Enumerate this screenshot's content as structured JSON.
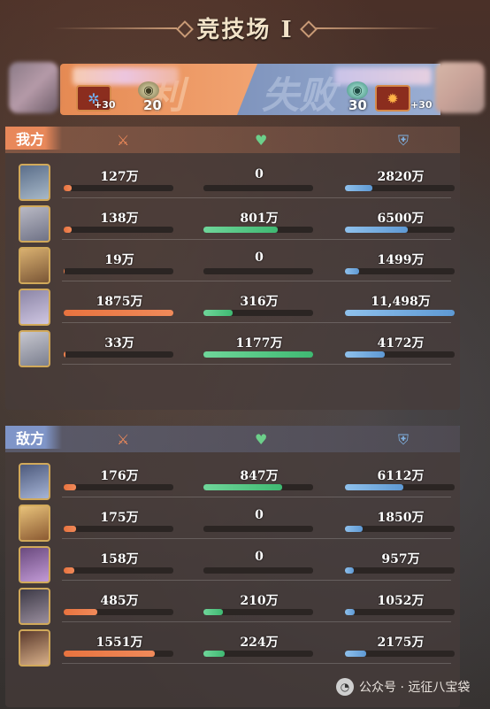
{
  "title": "竞技场 I",
  "banner": {
    "win_text": "利",
    "lose_text": "失败",
    "left_bonus": "+30",
    "left_level": "20",
    "right_level": "30",
    "right_bonus": "+30"
  },
  "stat_icons": {
    "damage": "sword-icon",
    "heal": "heart-icon",
    "defense": "shield-icon"
  },
  "colors": {
    "our_side": "#e8885a",
    "enemy_side": "#7f95c8",
    "damage": "#f08a5a",
    "heal": "#6ccf8a",
    "defense": "#7fb0e0"
  },
  "our_team": {
    "label": "我方",
    "rows": [
      {
        "damage": "127万",
        "heal": "0",
        "defense": "2820万",
        "damage_pct": 7,
        "heal_pct": 0,
        "defense_pct": 25
      },
      {
        "damage": "138万",
        "heal": "801万",
        "defense": "6500万",
        "damage_pct": 7,
        "heal_pct": 68,
        "defense_pct": 57
      },
      {
        "damage": "19万",
        "heal": "0",
        "defense": "1499万",
        "damage_pct": 1,
        "heal_pct": 0,
        "defense_pct": 13
      },
      {
        "damage": "1875万",
        "heal": "316万",
        "defense": "11,498万",
        "damage_pct": 100,
        "heal_pct": 27,
        "defense_pct": 100
      },
      {
        "damage": "33万",
        "heal": "1177万",
        "defense": "4172万",
        "damage_pct": 2,
        "heal_pct": 100,
        "defense_pct": 36
      }
    ]
  },
  "enemy_team": {
    "label": "敌方",
    "rows": [
      {
        "damage": "176万",
        "heal": "847万",
        "defense": "6112万",
        "damage_pct": 11,
        "heal_pct": 72,
        "defense_pct": 53
      },
      {
        "damage": "175万",
        "heal": "0",
        "defense": "1850万",
        "damage_pct": 11,
        "heal_pct": 0,
        "defense_pct": 16
      },
      {
        "damage": "158万",
        "heal": "0",
        "defense": "957万",
        "damage_pct": 10,
        "heal_pct": 0,
        "defense_pct": 8
      },
      {
        "damage": "485万",
        "heal": "210万",
        "defense": "1052万",
        "damage_pct": 31,
        "heal_pct": 18,
        "defense_pct": 9
      },
      {
        "damage": "1551万",
        "heal": "224万",
        "defense": "2175万",
        "damage_pct": 83,
        "heal_pct": 19,
        "defense_pct": 19
      }
    ]
  },
  "watermark": "公众号 · 远征八宝袋"
}
